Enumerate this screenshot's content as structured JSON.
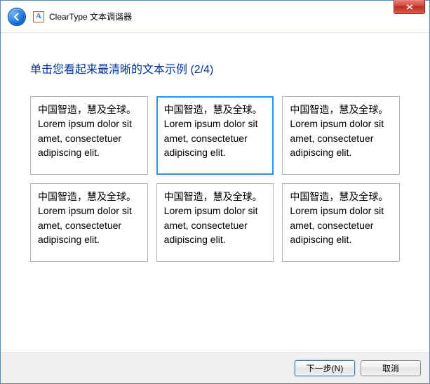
{
  "titlebar": {
    "app_title": "ClearType 文本调谐器"
  },
  "content": {
    "heading": "单击您看起来最清晰的文本示例 (2/4)",
    "sample_cjk": "中国智造，慧及全球。",
    "sample_latin": "Lorem ipsum dolor sit amet, consectetuer adipiscing elit.",
    "selected_index": 1
  },
  "footer": {
    "next_label": "下一步(N)",
    "cancel_label": "取消"
  }
}
